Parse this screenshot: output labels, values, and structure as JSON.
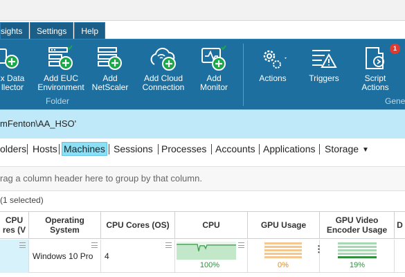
{
  "menu_tabs": [
    "sights",
    "Settings",
    "Help"
  ],
  "ribbon": {
    "buttons": {
      "add_data_collector": "x Data\nllector",
      "add_euc": "Add EUC\nEnvironment",
      "add_netscaler": "Add\nNetScaler",
      "add_cloud": "Add Cloud\nConnection",
      "add_monitor": "Add\nMonitor",
      "actions": "Actions",
      "triggers": "Triggers",
      "script_actions": "Script\nActions"
    },
    "group_labels": {
      "folder": "Folder",
      "general": "Gene"
    },
    "notification_count": "1",
    "colors": {
      "ribbon_bg": "#1d6f9f",
      "accent_green": "#1aa84a",
      "badge_red": "#e23a2e"
    }
  },
  "path": "mFenton\\AA_HSO'",
  "nav": {
    "items": [
      "olders",
      "Hosts",
      "Machines",
      "Sessions",
      "Processes",
      "Accounts",
      "Applications",
      "Storage"
    ],
    "active": "Machines",
    "dropdown_icon": "caret-down-icon"
  },
  "group_hint": "rag a column header here to group by that column.",
  "selection_info": "(1 selected)",
  "columns": [
    "CPU\nres (V",
    "Operating\nSystem",
    "CPU Cores (OS)",
    "CPU",
    "GPU Usage",
    "GPU Video\nEncoder Usage",
    "D"
  ],
  "row": {
    "os": "Windows 10 Pro",
    "cpu_cores": "4",
    "cpu_pct": "100%",
    "gpu_pct": "0%",
    "gpu_enc_pct": "19%"
  }
}
